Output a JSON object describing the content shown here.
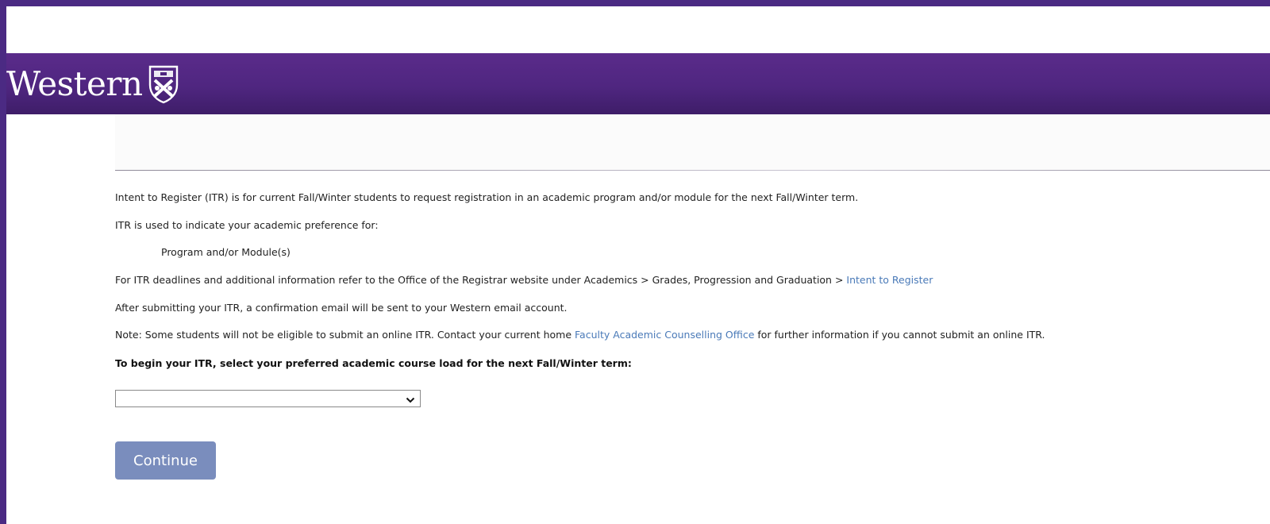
{
  "header": {
    "brand": "Western",
    "crest_icon": "western-crest-icon",
    "colors": {
      "purple": "#4f2680",
      "frame": "#4b2a83"
    }
  },
  "content": {
    "intro": "Intent to Register (ITR) is for current Fall/Winter students to request registration in an academic program and/or module for the next Fall/Winter term.",
    "used_for": "ITR is used to indicate your academic preference for:",
    "preference_item": "Program and/or Module(s)",
    "deadlines_text": "For ITR deadlines and additional information refer to the Office of the Registrar website under Academics > Grades, Progression and Graduation > ",
    "deadlines_link": "Intent to Register",
    "confirmation": "After submitting your ITR, a confirmation email will be sent to your Western email account.",
    "note_before": "Note: Some students will not be eligible to submit an online ITR. Contact your current home ",
    "note_link": "Faculty Academic Counselling Office",
    "note_after": " for further information if you cannot submit an online ITR.",
    "prompt": "To begin your ITR, select your preferred academic course load for the next Fall/Winter term:",
    "link_color": "#4a7ab8"
  },
  "form": {
    "course_load": {
      "selected": ""
    },
    "continue_label": "Continue",
    "button_color": "#7a8dbd"
  }
}
